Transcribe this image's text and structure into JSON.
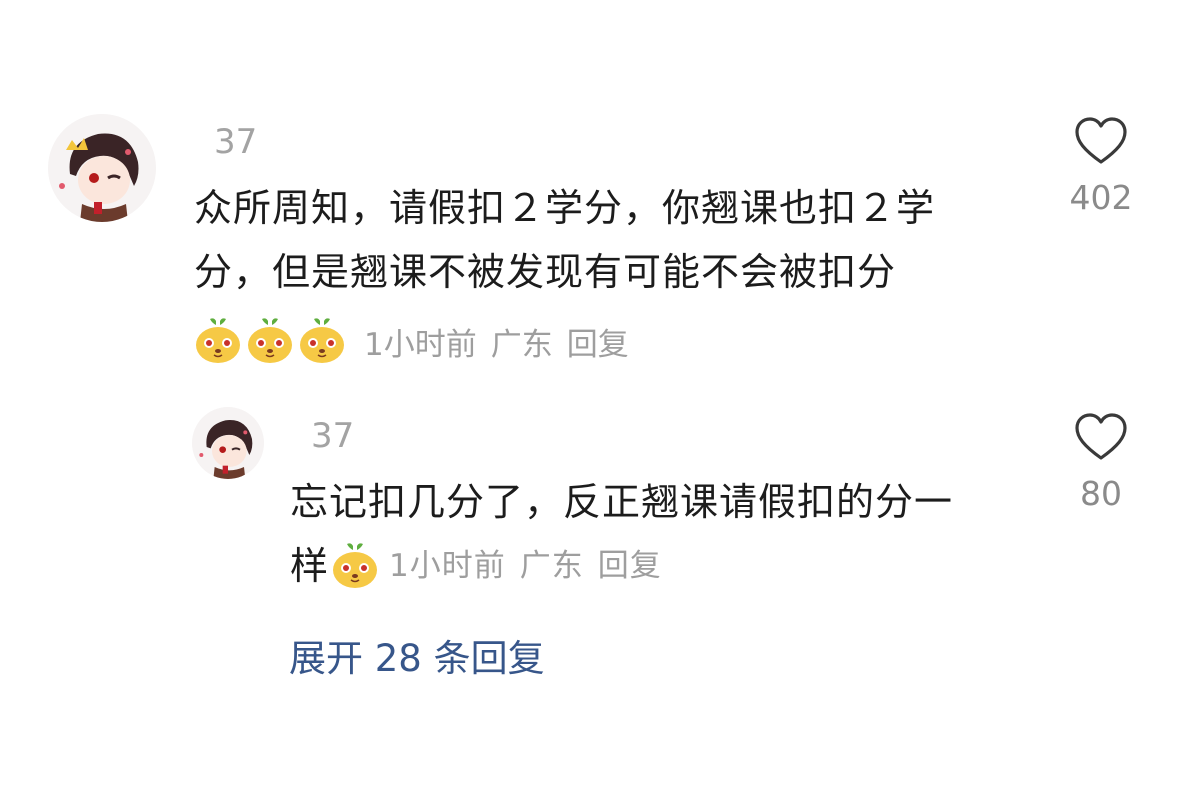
{
  "comments": [
    {
      "username": "37",
      "text_line1": "众所周知，请假扣２学分，你翘课也扣２学",
      "text_line2": "分，但是翘课不被发现有可能不会被扣分",
      "time": "1小时前",
      "location": "广东",
      "reply_label": "回复",
      "like_count": "402",
      "reactions": [
        "doge-emoji",
        "doge-emoji",
        "doge-emoji"
      ]
    }
  ],
  "reply": {
    "username": "37",
    "text_line1": "忘记扣几分了，反正翘课请假扣的分一",
    "text_line2": "样",
    "time": "1小时前",
    "location": "广东",
    "reply_label": "回复",
    "like_count": "80"
  },
  "expand_replies": "展开 28 条回复",
  "colors": {
    "text": "#1c1c1c",
    "meta": "#9e9e9e",
    "link": "#37568a",
    "heart": "#3a3a3a"
  }
}
